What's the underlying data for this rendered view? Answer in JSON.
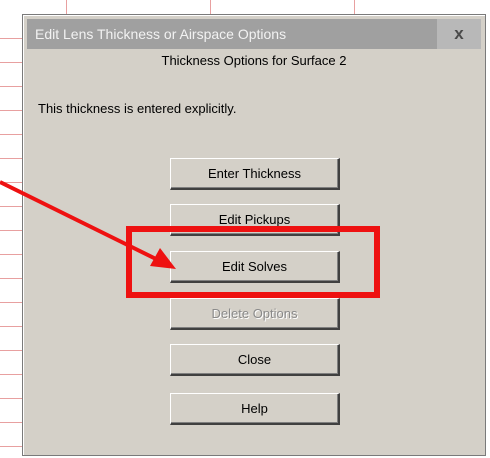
{
  "dialog": {
    "title": "Edit Lens Thickness or Airspace Options",
    "close_glyph": "x",
    "subtitle": "Thickness Options for Surface 2",
    "status_message": "This thickness is entered explicitly.",
    "buttons": [
      {
        "label": "Enter Thickness",
        "enabled": true
      },
      {
        "label": "Edit Pickups",
        "enabled": true
      },
      {
        "label": "Edit Solves",
        "enabled": true
      },
      {
        "label": "Delete Options",
        "enabled": false
      },
      {
        "label": "Close",
        "enabled": true
      },
      {
        "label": "Help",
        "enabled": true
      }
    ]
  },
  "annotation": {
    "highlight_color": "#ee1111",
    "highlighted_button": "Edit Solves"
  }
}
